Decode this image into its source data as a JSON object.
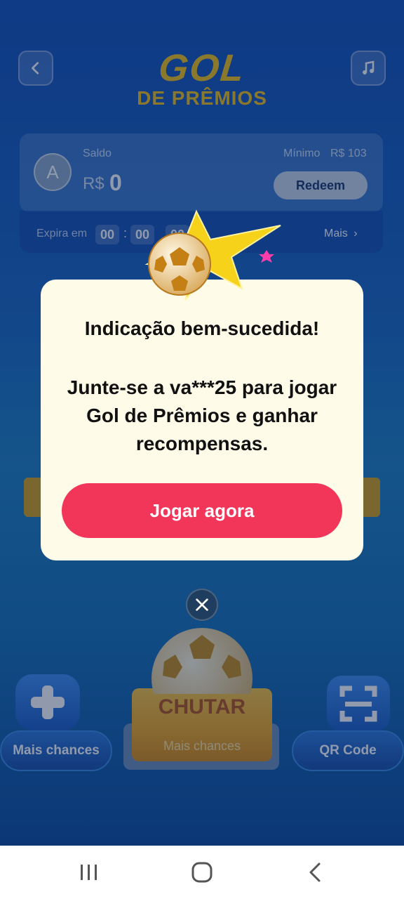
{
  "header": {
    "logo_line1": "GOL",
    "logo_line2": "DE PRÊMIOS",
    "back_icon": "chevron-left-icon",
    "music_icon": "music-note-icon"
  },
  "balance": {
    "avatar_letter": "A",
    "label": "Saldo",
    "currency": "R$",
    "amount": "0",
    "minimum_label": "Mínimo",
    "minimum_value": "R$ 103",
    "redeem_label": "Redeem"
  },
  "expiry": {
    "label": "Expira em",
    "hours": "00",
    "minutes": "00",
    "seconds": "00",
    "more_label": "Mais",
    "more_icon": "chevron-right-icon"
  },
  "modal": {
    "title": "Indicação bem-sucedida!",
    "message": "Junte-se a va***25 para jogar Gol de Prêmios e ganhar recompensas.",
    "button_label": "Jogar agora",
    "close_icon": "close-icon"
  },
  "bottom": {
    "more_chances_label": "Mais chances",
    "kick_label": "CHUTAR",
    "kick_sub_label": "Mais chances",
    "qr_label": "QR Code",
    "plus_icon": "plus-icon",
    "qr_icon": "qr-scan-icon"
  },
  "colors": {
    "accent": "#f2365a",
    "logo": "#f5c418",
    "background": "#1a65c0"
  }
}
